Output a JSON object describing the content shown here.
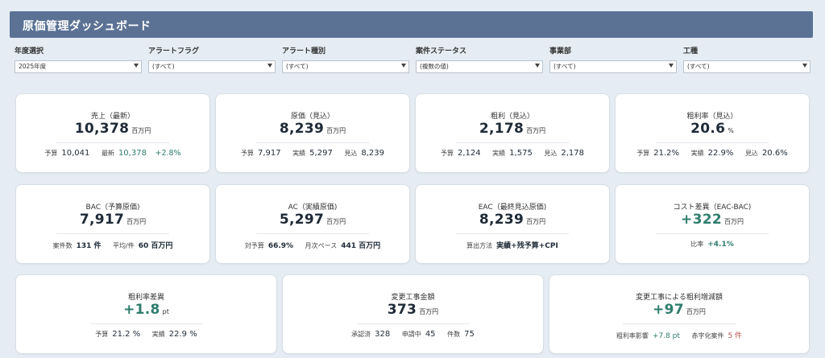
{
  "title": "原価管理ダッシュボード",
  "filters": [
    {
      "label": "年度選択",
      "value": "2025年度"
    },
    {
      "label": "アラートフラグ",
      "value": "(すべて)"
    },
    {
      "label": "アラート種別",
      "value": "(すべて)"
    },
    {
      "label": "案件ステータス",
      "value": "(複数の値)"
    },
    {
      "label": "事業部",
      "value": "(すべて)"
    },
    {
      "label": "工種",
      "value": "(すべて)"
    }
  ],
  "cards": {
    "sales": {
      "title": "売上（最新）",
      "value": "10,378",
      "unit": "百万円",
      "l1": "予算",
      "v1": "10,041",
      "l2": "最新",
      "v2": "10,378",
      "change": "+2.8%"
    },
    "cost": {
      "title": "原価（見込）",
      "value": "8,239",
      "unit": "百万円",
      "l1": "予算",
      "v1": "7,917",
      "l2": "実績",
      "v2": "5,297",
      "l3": "見込",
      "v3": "8,239"
    },
    "profit": {
      "title": "粗利（見込）",
      "value": "2,178",
      "unit": "百万円",
      "l1": "予算",
      "v1": "2,124",
      "l2": "実績",
      "v2": "1,575",
      "l3": "見込",
      "v3": "2,178"
    },
    "margin": {
      "title": "粗利率（見込）",
      "value": "20.6",
      "unit": "%",
      "l1": "予算",
      "v1": "21.2%",
      "l2": "実績",
      "v2": "22.9%",
      "l3": "見込",
      "v3": "20.6%"
    },
    "bac": {
      "title": "BAC（予算原価)",
      "value": "7,917",
      "unit": "百万円",
      "l1": "案件数",
      "v1": "131 件",
      "l2": "平均/件",
      "v2": "60 百万円"
    },
    "ac": {
      "title": "AC（実績原価)",
      "value": "5,297",
      "unit": "百万円",
      "l1": "対予算",
      "v1": "66.9%",
      "l2": "月次ペース",
      "v2": "441 百万円"
    },
    "eac": {
      "title": "EAC（最終見込原価)",
      "value": "8,239",
      "unit": "百万円",
      "l1": "算出方法",
      "v1": "実績+残予算+CPI"
    },
    "variance": {
      "title": "コスト差異（EAC-BAC)",
      "value": "+322",
      "unit": "百万円",
      "l1": "比率",
      "v1": "+4.1%"
    },
    "margin_diff": {
      "title": "粗利率差異",
      "value": "+1.8",
      "unit": "pt",
      "l1": "予算",
      "v1": "21.2 %",
      "l2": "実績",
      "v2": "22.9 %"
    },
    "change_amt": {
      "title": "変更工事金額",
      "value": "373",
      "unit": "百万円",
      "l1": "承認済",
      "v1": "328",
      "l2": "申請中",
      "v2": "45",
      "l3": "件数",
      "v3": "75"
    },
    "change_profit": {
      "title": "変更工事による粗利増減額",
      "value": "+97",
      "unit": "百万円",
      "l1": "粗利率影響",
      "v1": "+7.8 pt",
      "l2": "赤字化案件",
      "v2": "5 件"
    }
  }
}
